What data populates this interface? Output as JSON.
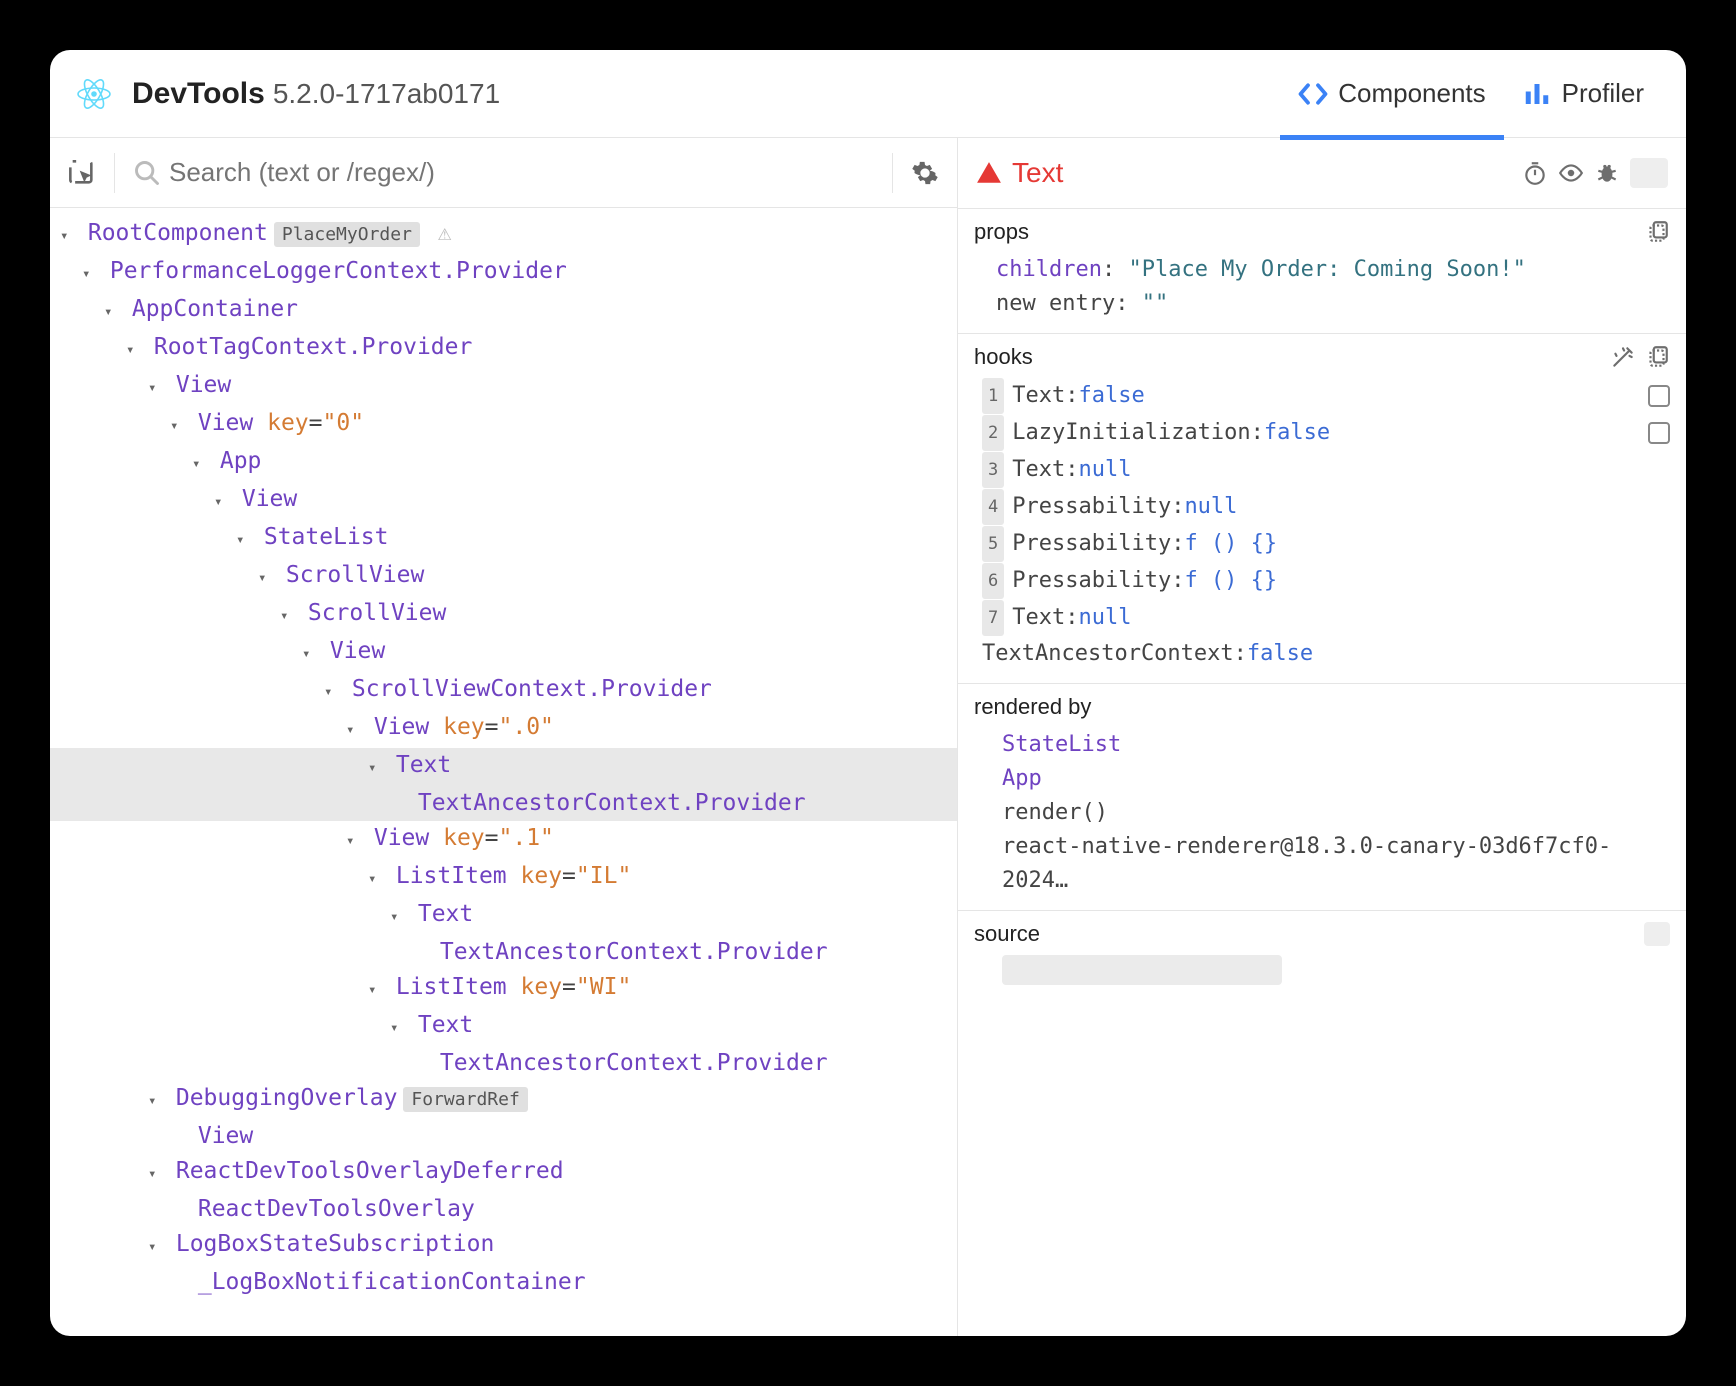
{
  "header": {
    "title": "DevTools",
    "version": "5.2.0-1717ab0171",
    "tabs": {
      "components": "Components",
      "profiler": "Profiler"
    }
  },
  "search": {
    "placeholder": "Search (text or /regex/)"
  },
  "tree": [
    {
      "indent": 0,
      "arrow": true,
      "name": "RootComponent",
      "badge": "PlaceMyOrder",
      "warn": true
    },
    {
      "indent": 1,
      "arrow": true,
      "name": "PerformanceLoggerContext.Provider"
    },
    {
      "indent": 2,
      "arrow": true,
      "name": "AppContainer"
    },
    {
      "indent": 3,
      "arrow": true,
      "name": "RootTagContext.Provider"
    },
    {
      "indent": 4,
      "arrow": true,
      "name": "View"
    },
    {
      "indent": 5,
      "arrow": true,
      "name": "View",
      "key": "\"0\""
    },
    {
      "indent": 6,
      "arrow": true,
      "name": "App"
    },
    {
      "indent": 7,
      "arrow": true,
      "name": "View"
    },
    {
      "indent": 8,
      "arrow": true,
      "name": "StateList"
    },
    {
      "indent": 9,
      "arrow": true,
      "name": "ScrollView"
    },
    {
      "indent": 10,
      "arrow": true,
      "name": "ScrollView"
    },
    {
      "indent": 11,
      "arrow": true,
      "name": "View"
    },
    {
      "indent": 12,
      "arrow": true,
      "name": "ScrollViewContext.Provider"
    },
    {
      "indent": 13,
      "arrow": true,
      "name": "View",
      "key": "\".0\""
    },
    {
      "indent": 14,
      "arrow": true,
      "name": "Text",
      "selected": true
    },
    {
      "indent": 15,
      "arrow": false,
      "name": "TextAncestorContext.Provider",
      "selected": true
    },
    {
      "indent": 13,
      "arrow": true,
      "name": "View",
      "key": "\".1\""
    },
    {
      "indent": 14,
      "arrow": true,
      "name": "ListItem",
      "key": "\"IL\""
    },
    {
      "indent": 15,
      "arrow": true,
      "name": "Text"
    },
    {
      "indent": 16,
      "arrow": false,
      "name": "TextAncestorContext.Provider"
    },
    {
      "indent": 14,
      "arrow": true,
      "name": "ListItem",
      "key": "\"WI\""
    },
    {
      "indent": 15,
      "arrow": true,
      "name": "Text"
    },
    {
      "indent": 16,
      "arrow": false,
      "name": "TextAncestorContext.Provider"
    },
    {
      "indent": 4,
      "arrow": true,
      "name": "DebuggingOverlay",
      "badge": "ForwardRef"
    },
    {
      "indent": 5,
      "arrow": false,
      "name": "View"
    },
    {
      "indent": 4,
      "arrow": true,
      "name": "ReactDevToolsOverlayDeferred"
    },
    {
      "indent": 5,
      "arrow": false,
      "name": "ReactDevToolsOverlay"
    },
    {
      "indent": 4,
      "arrow": true,
      "name": "LogBoxStateSubscription"
    },
    {
      "indent": 5,
      "arrow": false,
      "name": "_LogBoxNotificationContainer"
    }
  ],
  "selected": {
    "name": "Text"
  },
  "props": {
    "title": "props",
    "items": [
      {
        "key": "children",
        "plain": false,
        "value": "\"Place My Order: Coming Soon!\"",
        "isString": true
      },
      {
        "key": "new entry",
        "plain": true,
        "value": "\"\"",
        "isString": true
      }
    ]
  },
  "hooks": {
    "title": "hooks",
    "items": [
      {
        "num": "1",
        "label": "Text",
        "value": "false",
        "checkbox": true
      },
      {
        "num": "2",
        "label": "LazyInitialization",
        "value": "false",
        "checkbox": true
      },
      {
        "num": "3",
        "label": "Text",
        "value": "null"
      },
      {
        "num": "4",
        "label": "Pressability",
        "value": "null"
      },
      {
        "num": "5",
        "label": "Pressability",
        "value": "f () {}"
      },
      {
        "num": "6",
        "label": "Pressability",
        "value": "f () {}"
      },
      {
        "num": "7",
        "label": "Text",
        "value": "null"
      }
    ],
    "footer": {
      "label": "TextAncestorContext",
      "value": "false"
    }
  },
  "rendered": {
    "title": "rendered by",
    "items": [
      {
        "label": "StateList",
        "link": true
      },
      {
        "label": "App",
        "link": true
      },
      {
        "label": "render()",
        "link": false
      },
      {
        "label": "react-native-renderer@18.3.0-canary-03d6f7cf0-2024…",
        "link": false
      }
    ]
  },
  "source": {
    "title": "source"
  }
}
